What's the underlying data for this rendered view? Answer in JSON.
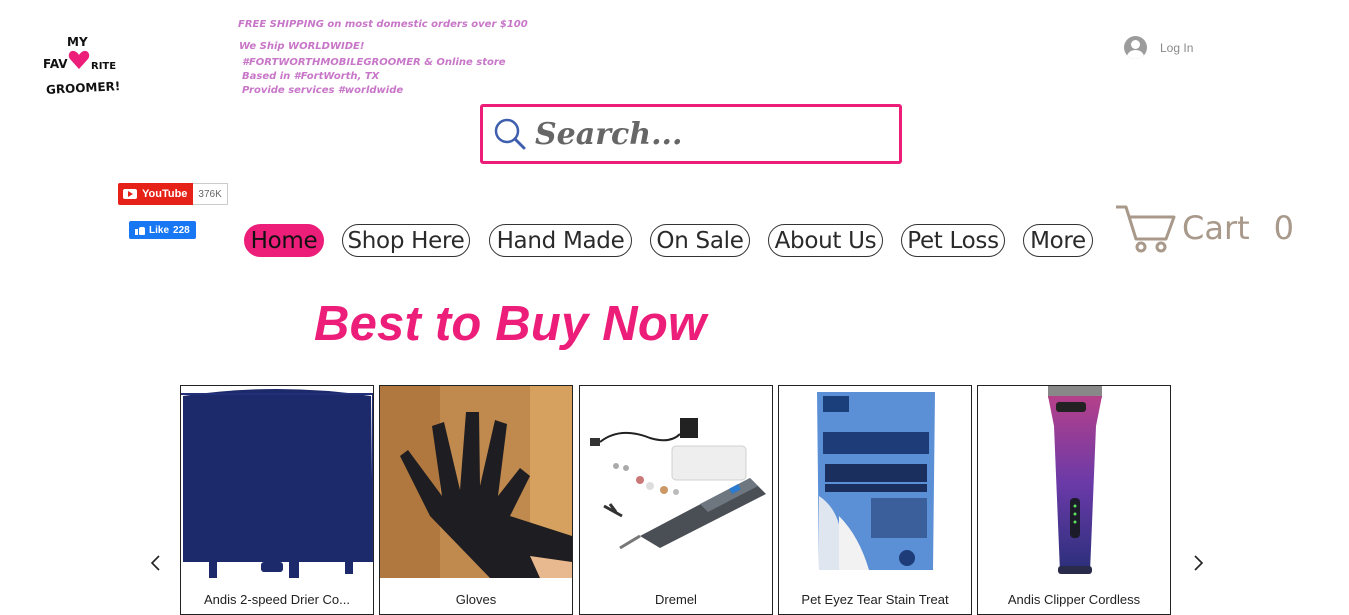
{
  "logo": {
    "line1": "MY",
    "line2a": "FAV",
    "line2b": "RITE",
    "line3": "GROOMER!"
  },
  "promo": {
    "line1": "FREE SHIPPING on most domestic orders over $100",
    "line2": "We Ship WORLDWIDE!",
    "line3": "#FORTWORTHMOBILEGROOMER & Online store",
    "line4": "Based in #FortWorth, TX",
    "line5": "Provide services #worldwide"
  },
  "login": {
    "label": "Log In"
  },
  "search": {
    "placeholder": "Search..."
  },
  "social": {
    "youtube": {
      "label": "YouTube",
      "count": "376K"
    },
    "facebook": {
      "label": "Like",
      "count": "228"
    }
  },
  "nav": {
    "items": [
      {
        "label": "Home",
        "active": true
      },
      {
        "label": "Shop Here"
      },
      {
        "label": "Hand Made"
      },
      {
        "label": "On Sale"
      },
      {
        "label": "About Us"
      },
      {
        "label": "Pet Loss"
      },
      {
        "label": "More"
      }
    ]
  },
  "cart": {
    "label": "Cart",
    "count": "0"
  },
  "section": {
    "heading": "Best to Buy Now"
  },
  "products": [
    {
      "name": "Andis 2-speed Drier Co...",
      "icon": "dryer-cover-image"
    },
    {
      "name": "Gloves",
      "icon": "gloves-image"
    },
    {
      "name": "Dremel",
      "icon": "dremel-image"
    },
    {
      "name": "Pet Eyez Tear Stain Treat",
      "icon": "peteyez-image"
    },
    {
      "name": "Andis Clipper Cordless",
      "icon": "clipper-image"
    }
  ],
  "colors": {
    "accent": "#ec1e79",
    "promo": "#c876c8",
    "cart": "#a8998a"
  }
}
